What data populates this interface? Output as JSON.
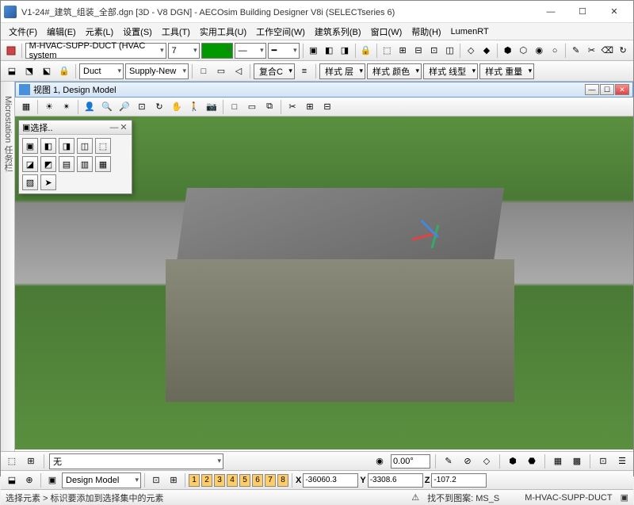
{
  "window": {
    "title": "V1-24#_建筑_组装_全部.dgn [3D - V8 DGN] - AECOsim Building Designer V8i (SELECTseries 6)"
  },
  "menus": [
    "文件(F)",
    "编辑(E)",
    "元素(L)",
    "设置(S)",
    "工具(T)",
    "实用工具(U)",
    "工作空间(W)",
    "建筑系列(B)",
    "窗口(W)",
    "帮助(H)",
    "LumenRT"
  ],
  "toolbar1": {
    "layer_combo": "M-HVAC-SUPP-DUCT (HVAC system",
    "num": "7"
  },
  "toolbar2": {
    "mode1": "Duct",
    "mode2": "Supply-New",
    "btn_combine": "复合C",
    "style_layer": "样式 层",
    "style_color": "样式 颜色",
    "style_line": "样式 线型",
    "style_weight": "样式 重量"
  },
  "sidebar_label": "Microstation 任务栏",
  "view": {
    "title": "视图 1, Design Model"
  },
  "select_panel": {
    "title": "选择..",
    "min": "—",
    "close": "✕"
  },
  "status1": {
    "combo": "无",
    "val": "0.00°"
  },
  "coords": {
    "model": "Design Model",
    "nums": [
      "1",
      "2",
      "3",
      "4",
      "5",
      "6",
      "7",
      "8"
    ],
    "x": "-36060.3",
    "y": "-3308.6",
    "z": "-107.2"
  },
  "bottom": {
    "left": "选择元素 > 标识要添加到选择集中的元素",
    "mid": "找不到图案: MS_S",
    "right": "M-HVAC-SUPP-DUCT"
  }
}
